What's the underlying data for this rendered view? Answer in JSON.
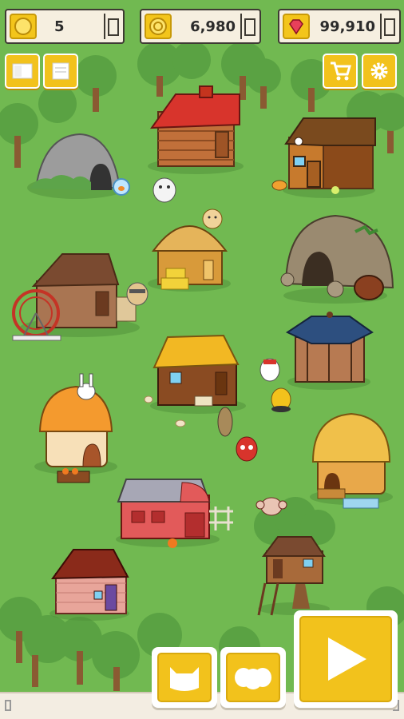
{
  "currency": {
    "coins": "5",
    "gold": "6,980",
    "gems": "99,910"
  },
  "icons": {
    "coin": "coin-icon",
    "gold": "gold-coin-icon",
    "gem": "gem-icon",
    "card": "card-icon",
    "list": "list-icon",
    "cart": "shopping-cart-icon",
    "gear": "gear-icon",
    "cat": "cat-icon",
    "pets": "pets-icon",
    "play": "play-icon"
  },
  "colors": {
    "grass": "#71b951",
    "button": "#f2c21c",
    "panel": "#f6efe0"
  }
}
